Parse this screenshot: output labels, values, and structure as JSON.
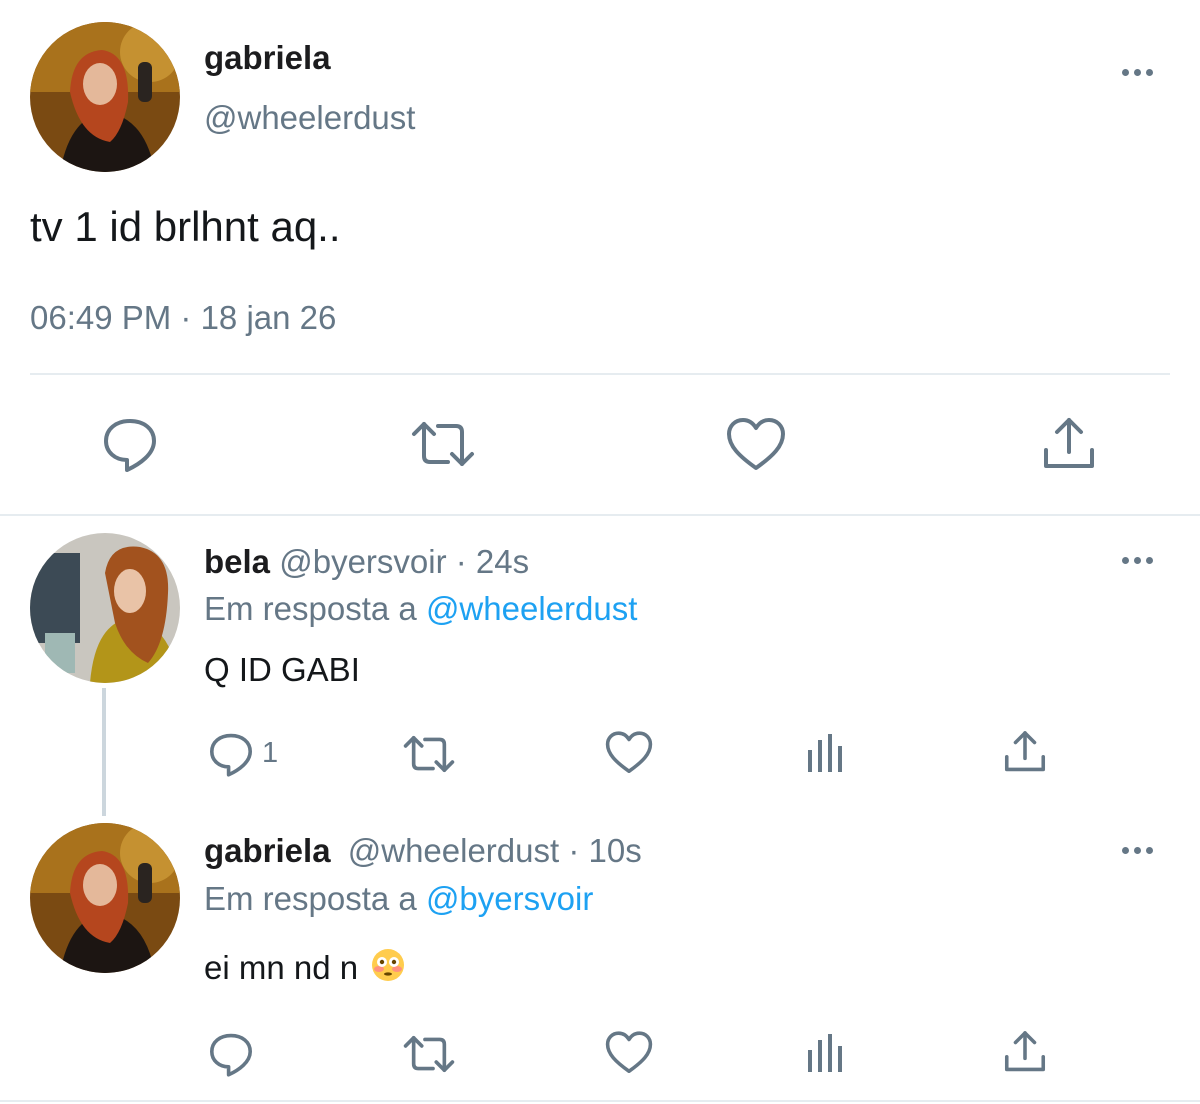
{
  "main_tweet": {
    "author_name": "gabriela",
    "handle": "@wheelerdust",
    "text": "tv 1 id brlhnt aq..",
    "timestamp": "06:49 PM · 18 jan 26"
  },
  "replies": [
    {
      "author_name": "bela",
      "meta": "@byersvoir · 24s",
      "reply_prefix": "Em resposta a",
      "reply_to": "@wheelerdust",
      "text": "Q ID GABI",
      "reply_count": "1"
    },
    {
      "author_name": "gabriela",
      "meta": "@wheelerdust · 10s",
      "reply_prefix": "Em resposta a",
      "reply_to": "@byersvoir",
      "text": "ei mn nd n",
      "emoji": "flushed-face"
    }
  ],
  "icons": {
    "reply": "reply-icon",
    "retweet": "retweet-icon",
    "like": "like-icon",
    "share": "share-icon",
    "analytics": "analytics-icon",
    "more": "more-options-icon"
  },
  "colors": {
    "text": "#14171a",
    "secondary": "#657786",
    "link": "#1da1f2",
    "divider": "#e6ecf0"
  }
}
